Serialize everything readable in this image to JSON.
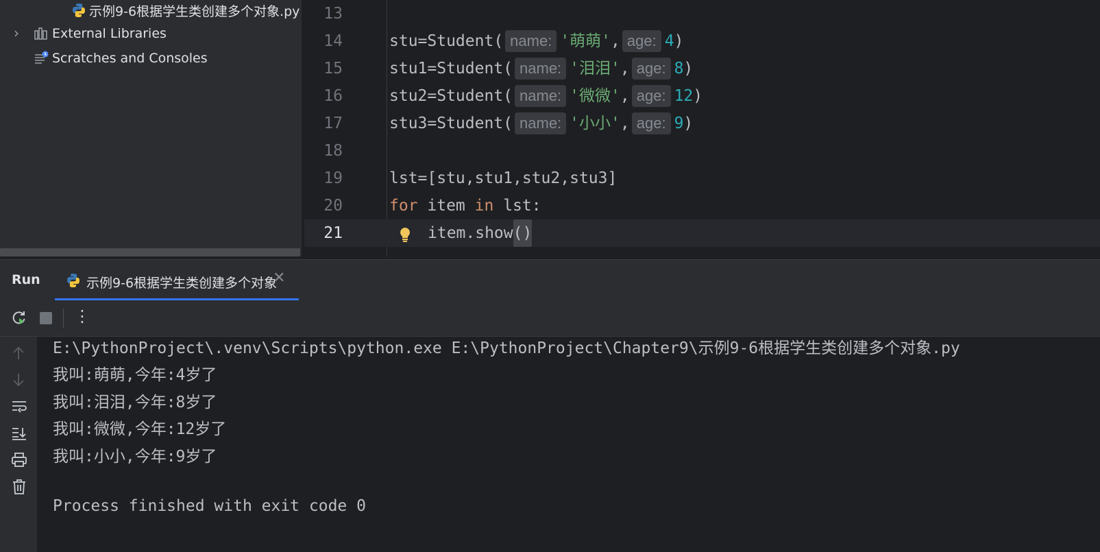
{
  "project_tree": {
    "file_item": "示例9-6根据学生类创建多个对象.py",
    "external_libraries": "External Libraries",
    "scratches": "Scratches and Consoles"
  },
  "editor": {
    "lines": [
      {
        "num": "13"
      },
      {
        "num": "14",
        "var": "stu=Student(",
        "hint_name": "name:",
        "str": "'萌萌'",
        "comma": ",",
        "hint_age": "age:",
        "age": "4",
        "close": ")"
      },
      {
        "num": "15",
        "var": "stu1=Student(",
        "hint_name": "name:",
        "str": "'泪泪'",
        "comma": ",",
        "hint_age": "age:",
        "age": "8",
        "close": ")"
      },
      {
        "num": "16",
        "var": "stu2=Student(",
        "hint_name": "name:",
        "str": "'微微'",
        "comma": ",",
        "hint_age": "age:",
        "age": "12",
        "close": ")"
      },
      {
        "num": "17",
        "var": "stu3=Student(",
        "hint_name": "name:",
        "str": "'小小'",
        "comma": ",",
        "hint_age": "age:",
        "age": "9",
        "close": ")"
      },
      {
        "num": "18"
      },
      {
        "num": "19",
        "text": "lst=[stu,stu1,stu2,stu3]"
      },
      {
        "num": "20",
        "kw_for": "for",
        "mid": " item ",
        "kw_in": "in",
        "rest": " lst:"
      },
      {
        "num": "21",
        "text": "item.show",
        "paren": "()"
      }
    ]
  },
  "run": {
    "title": "Run",
    "tab_label": "示例9-6根据学生类创建多个对象",
    "close_glyph": "✕",
    "more_glyph": "⋮",
    "console": [
      "E:\\PythonProject\\.venv\\Scripts\\python.exe E:\\PythonProject\\Chapter9\\示例9-6根据学生类创建多个对象.py",
      "我叫:萌萌,今年:4岁了",
      "我叫:泪泪,今年:8岁了",
      "我叫:微微,今年:12岁了",
      "我叫:小小,今年:9岁了",
      "",
      "Process finished with exit code 0"
    ]
  },
  "colors": {
    "accent": "#3574f0",
    "string": "#6aab73",
    "number": "#2aacb8",
    "keyword": "#cf8e6d"
  }
}
